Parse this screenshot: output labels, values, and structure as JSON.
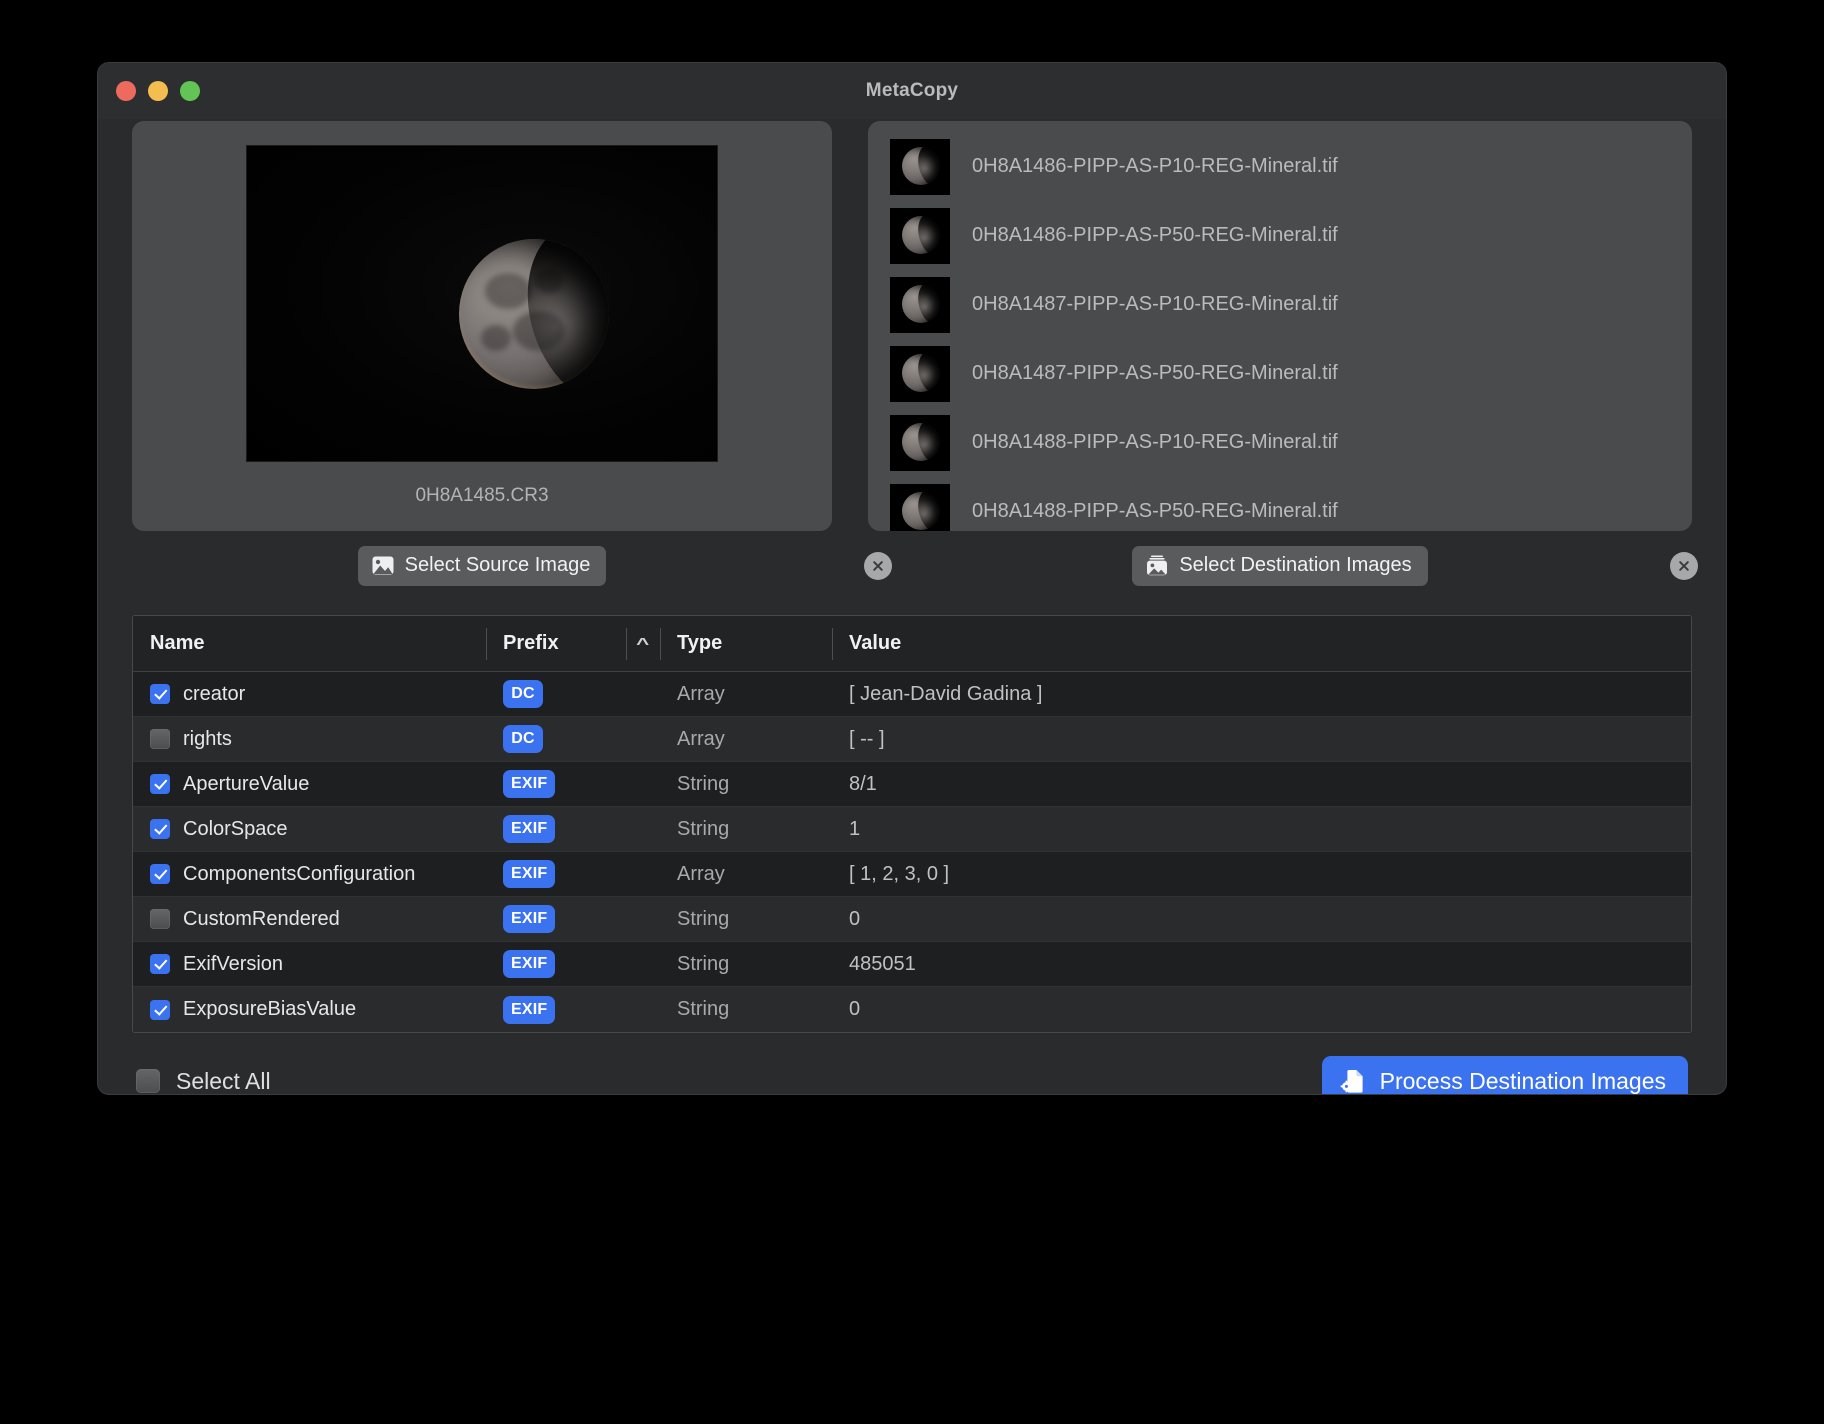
{
  "window": {
    "title": "MetaCopy",
    "traffic_lights": [
      {
        "name": "close",
        "color": "#ed6a5e"
      },
      {
        "name": "minimize",
        "color": "#f4bd4f"
      },
      {
        "name": "zoom",
        "color": "#61c454"
      }
    ]
  },
  "source_panel": {
    "filename": "0H8A1485.CR3",
    "select_button": {
      "label": "Select Source Image",
      "icon": "photo-icon"
    },
    "clear_button": {
      "icon": "close-circle-icon"
    }
  },
  "destination_panel": {
    "select_button": {
      "label": "Select Destination Images",
      "icon": "photo-stack-icon"
    },
    "clear_button": {
      "icon": "close-circle-icon"
    },
    "items": [
      {
        "filename": "0H8A1486-PIPP-AS-P10-REG-Mineral.tif"
      },
      {
        "filename": "0H8A1486-PIPP-AS-P50-REG-Mineral.tif"
      },
      {
        "filename": "0H8A1487-PIPP-AS-P10-REG-Mineral.tif"
      },
      {
        "filename": "0H8A1487-PIPP-AS-P50-REG-Mineral.tif"
      },
      {
        "filename": "0H8A1488-PIPP-AS-P10-REG-Mineral.tif"
      },
      {
        "filename": "0H8A1488-PIPP-AS-P50-REG-Mineral.tif"
      }
    ]
  },
  "table": {
    "columns": {
      "name": "Name",
      "prefix": "Prefix",
      "type": "Type",
      "value": "Value"
    },
    "sort": {
      "column": "Prefix",
      "direction": "ascending",
      "indicator": "^"
    },
    "rows": [
      {
        "checked": true,
        "name": "creator",
        "prefix": "DC",
        "type": "Array",
        "value": "[ Jean-David Gadina ]"
      },
      {
        "checked": false,
        "name": "rights",
        "prefix": "DC",
        "type": "Array",
        "value": "[ -- ]"
      },
      {
        "checked": true,
        "name": "ApertureValue",
        "prefix": "EXIF",
        "type": "String",
        "value": "8/1"
      },
      {
        "checked": true,
        "name": "ColorSpace",
        "prefix": "EXIF",
        "type": "String",
        "value": "1"
      },
      {
        "checked": true,
        "name": "ComponentsConfiguration",
        "prefix": "EXIF",
        "type": "Array",
        "value": "[ 1, 2, 3, 0 ]"
      },
      {
        "checked": false,
        "name": "CustomRendered",
        "prefix": "EXIF",
        "type": "String",
        "value": "0"
      },
      {
        "checked": true,
        "name": "ExifVersion",
        "prefix": "EXIF",
        "type": "String",
        "value": "485051"
      },
      {
        "checked": true,
        "name": "ExposureBiasValue",
        "prefix": "EXIF",
        "type": "String",
        "value": "0"
      }
    ]
  },
  "footer": {
    "select_all": {
      "label": "Select All",
      "checked": false
    },
    "process_button": {
      "label": "Process Destination Images",
      "icon": "process-file-icon"
    }
  },
  "colors": {
    "accent": "#3b72f0",
    "window_background": "#2a2b2d",
    "panel_background": "#4a4b4d",
    "table_background": "#1f2123",
    "text_primary": "#e6e7e8",
    "text_secondary": "#a7a9ab"
  }
}
